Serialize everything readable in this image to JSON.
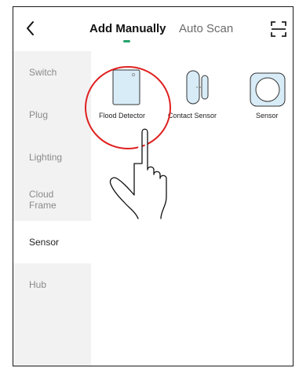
{
  "header": {
    "back_icon": "chevron-left-icon",
    "tabs": [
      {
        "label": "Add Manually",
        "active": true
      },
      {
        "label": "Auto Scan",
        "active": false
      }
    ],
    "scan_icon": "scan-frame-icon",
    "accent_color": "#27a36c"
  },
  "sidebar": {
    "items": [
      {
        "label": "Switch",
        "active": false
      },
      {
        "label": "Plug",
        "active": false
      },
      {
        "label": "Lighting",
        "active": false
      },
      {
        "label": "Cloud\nFrame",
        "active": false
      },
      {
        "label": "Sensor",
        "active": true
      },
      {
        "label": "Hub",
        "active": false
      }
    ]
  },
  "devices": [
    {
      "label": "Flood Detector",
      "icon": "flood-detector-icon",
      "highlighted": true
    },
    {
      "label": "Contact Sensor",
      "icon": "contact-sensor-icon",
      "highlighted": false
    },
    {
      "label": "Sensor",
      "icon": "sensor-icon",
      "highlighted": false
    }
  ],
  "annotation": {
    "circle_color": "#e02020",
    "pointer_icon": "hand-pointer-icon"
  }
}
